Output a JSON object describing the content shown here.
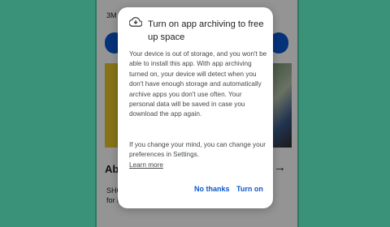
{
  "background": {
    "stat_fragment": "3M",
    "section_heading": "Ab",
    "desc_fragment_1": "SHC",
    "desc_fragment_2": "for i",
    "arrow_glyph": "→"
  },
  "dialog": {
    "icon": "cloud-download-icon",
    "title": "Turn on app archiving to free up space",
    "body": "Your device is out of storage, and you won't be able to install this app. With app archiving turned on, your device will detect when you don't have enough storage and automatically archive apps you don't use often. Your personal data will be saved in case you download the app again.",
    "body2": "If you change your mind, you can change your preferences in Settings.",
    "learn_more": "Learn more",
    "buttons": {
      "negative": "No thanks",
      "positive": "Turn on"
    }
  },
  "colors": {
    "background": "#3a9279",
    "accent": "#0b57d0",
    "scrim": "rgba(0,0,0,0.42)"
  }
}
